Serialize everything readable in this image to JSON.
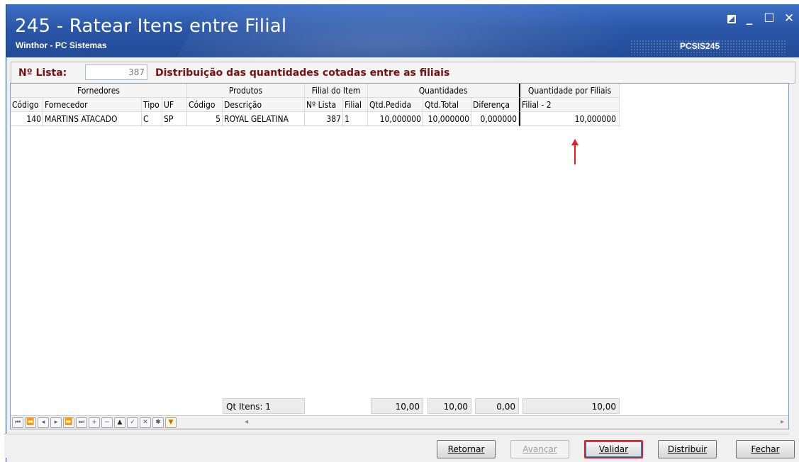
{
  "window": {
    "title": "245 - Ratear Itens entre Filial",
    "subtitle": "Winthor - PC Sistemas",
    "code": "PCSIS245"
  },
  "header": {
    "lista_label": "Nº Lista:",
    "lista_value": "387",
    "description": "Distribuição das quantidades cotadas entre as filiais"
  },
  "grid": {
    "groups": [
      "Fornedores",
      "Produtos",
      "Filial do Item",
      "Quantidades",
      "Quantidade por Filiais"
    ],
    "columns": [
      "Código",
      "Fornecedor",
      "Tipo",
      "UF",
      "Código",
      "Descrição",
      "Nº Lista",
      "Filial",
      "Qtd.Pedida",
      "Qtd.Total",
      "Diferença",
      "Filial - 2"
    ],
    "rows": [
      [
        "140",
        "MARTINS ATACADO",
        "C",
        "SP",
        "5",
        "ROYAL GELATINA",
        "387",
        "1",
        "10,000000",
        "10,000000",
        "0,000000",
        "10,000000"
      ]
    ],
    "footer": {
      "qt_itens": "Qt Itens: 1",
      "qtd_pedida": "10,00",
      "qtd_total": "10,00",
      "diferenca": "0,00",
      "filial_2": "10,00"
    }
  },
  "buttons": {
    "retornar": "Retornar",
    "avancar": "Avançar",
    "validar": "Validar",
    "distribuir": "Distribuir",
    "fechar": "Fechar"
  },
  "colors": {
    "title_bar": "#2a57a8",
    "label_red": "#7b1010",
    "focus_red": "#e02020"
  }
}
